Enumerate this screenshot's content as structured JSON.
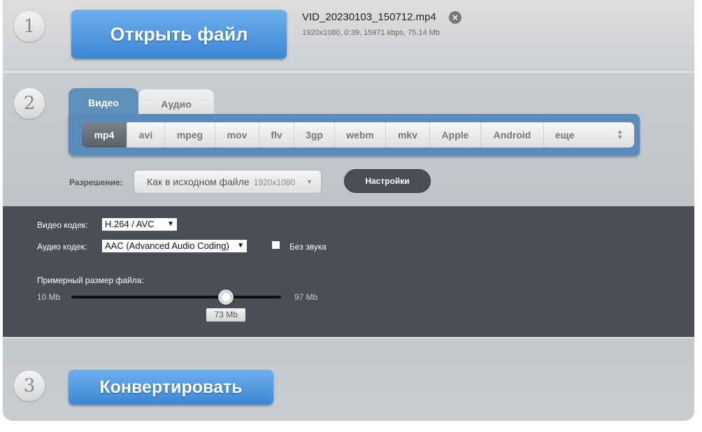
{
  "step1": {
    "number": "1",
    "open_button": "Открыть файл",
    "file_name": "VID_20230103_150712.mp4",
    "file_info": "1920x1080, 0:39, 15971 kbps, 75.14 Mb",
    "remove_icon": "close-circle-icon"
  },
  "step2": {
    "number": "2",
    "tabs": [
      {
        "label": "Видео",
        "active": true
      },
      {
        "label": "Аудио",
        "active": false
      }
    ],
    "formats": [
      {
        "label": "mp4",
        "selected": true
      },
      {
        "label": "avi"
      },
      {
        "label": "mpeg"
      },
      {
        "label": "mov"
      },
      {
        "label": "flv"
      },
      {
        "label": "3gp"
      },
      {
        "label": "webm"
      },
      {
        "label": "mkv"
      },
      {
        "label": "Apple"
      },
      {
        "label": "Android"
      },
      {
        "label": "еще"
      }
    ],
    "resolution_label": "Разрешение:",
    "resolution_value": "Как в исходном файле",
    "resolution_size": "1920x1080",
    "settings_button": "Настройки"
  },
  "settings": {
    "video_codec_label": "Видео кодек:",
    "video_codec": "H.264 / AVC",
    "audio_codec_label": "Аудио кодек:",
    "audio_codec": "AAC (Advanced Audio Coding)",
    "mute_label": "Без звука",
    "mute_checked": false,
    "size_label": "Примерный размер файла:",
    "size_min": "10 Mb",
    "size_max": "97 Mb",
    "size_value": "73 Mb",
    "size_min_value": 10,
    "size_max_value": 97,
    "size_current": 73
  },
  "step3": {
    "number": "3",
    "convert_button": "Конвертировать"
  },
  "colors": {
    "accent_blue": "#4a90dc",
    "tab_blue": "#5b8cb9",
    "dark_panel": "#4a4e56"
  }
}
